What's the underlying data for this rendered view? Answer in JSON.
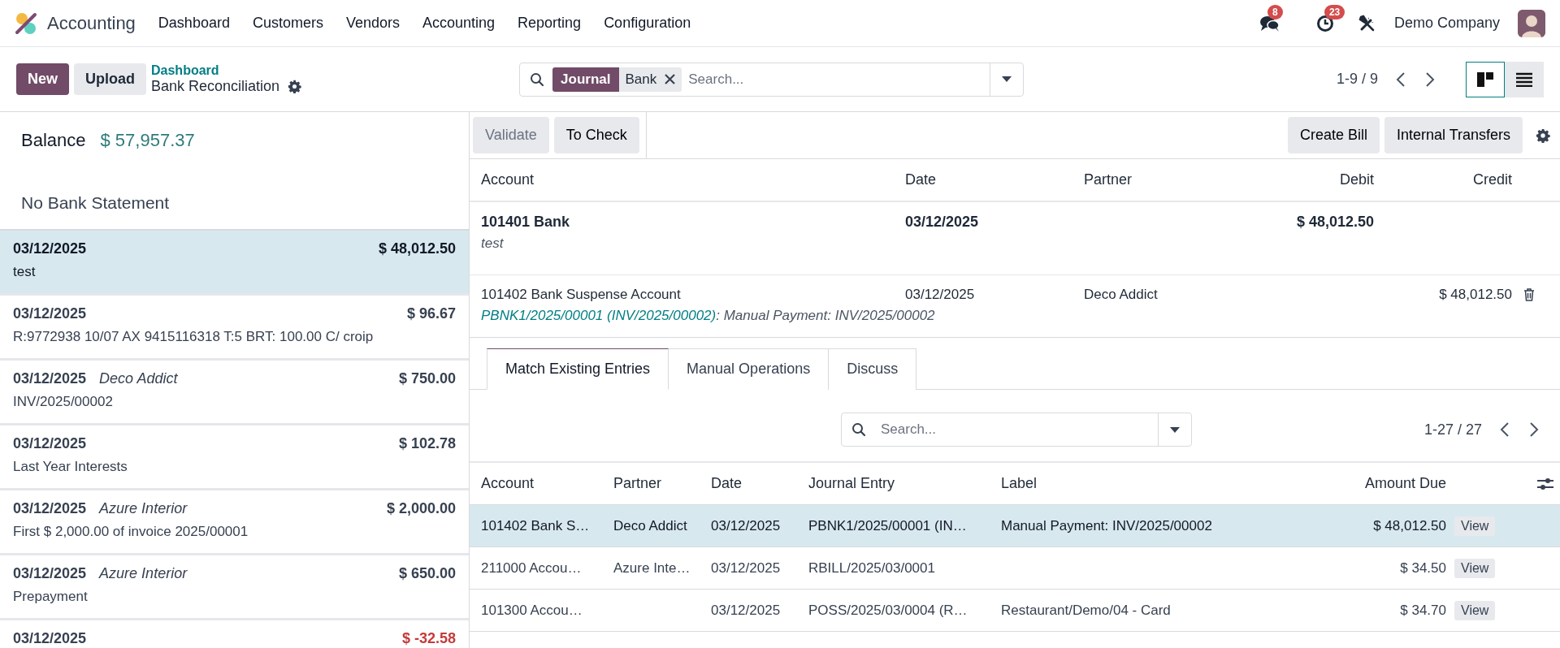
{
  "navbar": {
    "app_name": "Accounting",
    "menu": [
      "Dashboard",
      "Customers",
      "Vendors",
      "Accounting",
      "Reporting",
      "Configuration"
    ],
    "messages_badge": "8",
    "activities_badge": "23",
    "company": "Demo Company"
  },
  "control_panel": {
    "buttons": [
      {
        "label": "New",
        "kind": "primary"
      },
      {
        "label": "Upload",
        "kind": "secondary"
      }
    ],
    "breadcrumb": "Dashboard",
    "title": "Bank Reconciliation",
    "search": {
      "facet_label": "Journal",
      "facet_value": "Bank",
      "placeholder": "Search..."
    },
    "pager": "1-9 / 9",
    "views": [
      {
        "kind": "kanban",
        "selected": true
      },
      {
        "kind": "list",
        "selected": false
      }
    ]
  },
  "left_panel": {
    "balance_label": "Balance",
    "balance": "$ 57,957.37",
    "statement": "No Bank Statement",
    "lines": [
      {
        "date": "03/12/2025",
        "amount": "$ 48,012.50",
        "label": "test",
        "selected": true,
        "negative": false
      },
      {
        "date": "03/12/2025",
        "amount": "$ 96.67",
        "label": "R:9772938 10/07 AX 9415116318 T:5 BRT: 100.00 C/ croip",
        "selected": false,
        "negative": false
      },
      {
        "date": "03/12/2025",
        "partner": "Deco Addict",
        "amount": "$ 750.00",
        "label": "INV/2025/00002",
        "selected": false,
        "negative": false
      },
      {
        "date": "03/12/2025",
        "amount": "$ 102.78",
        "label": "Last Year Interests",
        "selected": false,
        "negative": false
      },
      {
        "date": "03/12/2025",
        "partner": "Azure Interior",
        "amount": "$ 2,000.00",
        "label": "First $ 2,000.00 of invoice 2025/00001",
        "selected": false,
        "negative": false
      },
      {
        "date": "03/12/2025",
        "partner": "Azure Interior",
        "amount": "$ 650.00",
        "label": "Prepayment",
        "selected": false,
        "negative": false
      },
      {
        "date": "03/12/2025",
        "amount": "$ -32.58",
        "selected": false,
        "negative": true
      }
    ]
  },
  "toolbar": {
    "left_buttons": [
      {
        "label": "Validate",
        "disabled": true
      },
      {
        "label": "To Check",
        "disabled": false
      }
    ],
    "right_buttons": [
      "Create Bill",
      "Internal Transfers"
    ]
  },
  "entries_table": {
    "columns": [
      "Account",
      "Date",
      "Partner",
      "Debit",
      "Credit"
    ],
    "rows": [
      {
        "kind": "bank",
        "account": "101401 Bank",
        "date": "03/12/2025",
        "debit": "$ 48,012.50",
        "note": "test"
      },
      {
        "kind": "counterpart",
        "account": "101402 Bank Suspense Account",
        "date": "03/12/2025",
        "partner": "Deco Addict",
        "credit": "$ 48,012.50",
        "ref": "PBNK1/2025/00001 (INV/2025/00002)",
        "note": ": Manual Payment: INV/2025/00002"
      }
    ]
  },
  "tabs": [
    {
      "label": "Match Existing Entries",
      "selected": true
    },
    {
      "label": "Manual Operations",
      "selected": false
    },
    {
      "label": "Discuss",
      "selected": false
    }
  ],
  "match": {
    "search": {
      "placeholder": "Search..."
    },
    "pager": "1-27 / 27",
    "columns": [
      "Account",
      "Partner",
      "Date",
      "Journal Entry",
      "Label",
      "Amount Due"
    ],
    "rows": [
      {
        "cells": [
          "101402 Bank S…",
          "Deco Addict",
          "03/12/2025",
          "PBNK1/2025/00001 (IN…",
          "Manual Payment: INV/2025/00002",
          "$ 48,012.50"
        ],
        "action": "View",
        "selected": true
      },
      {
        "cells": [
          "211000 Accou…",
          "Azure Inte…",
          "03/12/2025",
          "RBILL/2025/03/0001",
          null,
          "$ 34.50"
        ],
        "action": "View",
        "selected": false
      },
      {
        "cells": [
          "101300 Accou…",
          null,
          "03/12/2025",
          "POSS/2025/03/0004 (R…",
          "Restaurant/Demo/04 - Card",
          "$ 34.70"
        ],
        "action": "View",
        "selected": false
      }
    ]
  }
}
